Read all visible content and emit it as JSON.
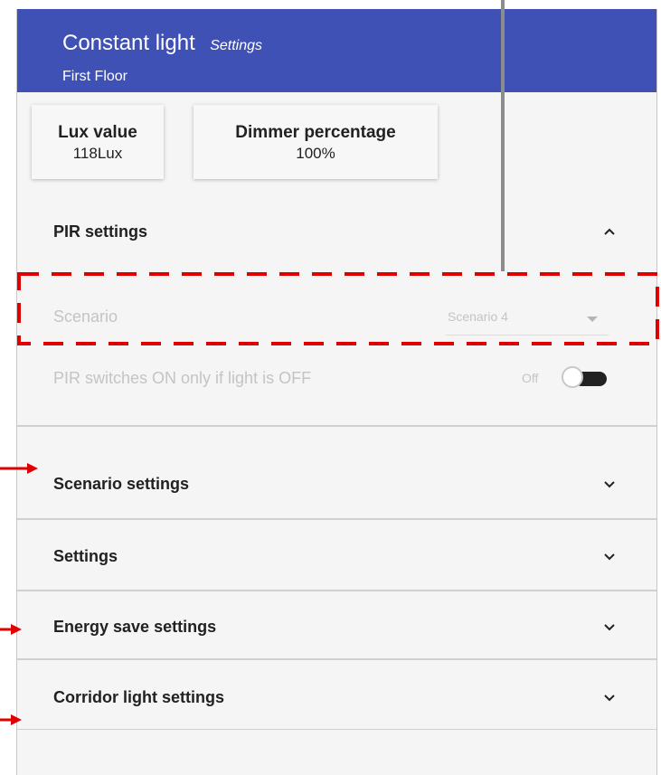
{
  "header": {
    "title": "Constant light",
    "subtitle": "Settings",
    "location": "First Floor"
  },
  "tiles": [
    {
      "label": "Lux value",
      "value": "118Lux"
    },
    {
      "label": "Dimmer percentage",
      "value": "100%"
    }
  ],
  "pir": {
    "title": "PIR settings",
    "scenario_label": "Scenario",
    "scenario_value": "Scenario 4",
    "switch_label": "PIR switches ON only if light is OFF",
    "switch_state": "Off"
  },
  "sections": [
    {
      "title": "Scenario settings"
    },
    {
      "title": "Settings"
    },
    {
      "title": "Energy save settings"
    },
    {
      "title": "Corridor light settings"
    }
  ],
  "colors": {
    "header": "#3f51b5",
    "annotation": "#e00000"
  }
}
